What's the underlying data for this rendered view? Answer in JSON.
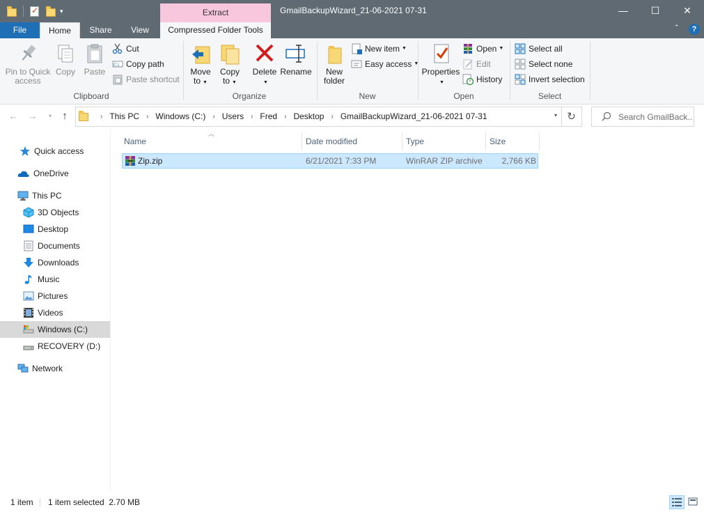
{
  "window": {
    "title": "GmailBackupWizard_21-06-2021 07-31",
    "contextual_tab_header": "Extract",
    "minimize": "—",
    "maximize": "☐",
    "close": "✕"
  },
  "ribbon_tabs": [
    "File",
    "Home",
    "Share",
    "View",
    "Compressed Folder Tools"
  ],
  "ribbon": {
    "clipboard": {
      "label": "Clipboard",
      "pin": [
        "Pin to Quick",
        "access"
      ],
      "copy": "Copy",
      "paste": "Paste",
      "cut": "Cut",
      "copy_path": "Copy path",
      "paste_shortcut": "Paste shortcut"
    },
    "organize": {
      "label": "Organize",
      "move_to": [
        "Move",
        "to"
      ],
      "copy_to": [
        "Copy",
        "to"
      ],
      "delete": "Delete",
      "rename": "Rename"
    },
    "new": {
      "label": "New",
      "new_folder": [
        "New",
        "folder"
      ],
      "new_item": "New item",
      "easy_access": "Easy access"
    },
    "open": {
      "label": "Open",
      "properties": "Properties",
      "open": "Open",
      "edit": "Edit",
      "history": "History"
    },
    "select": {
      "label": "Select",
      "select_all": "Select all",
      "select_none": "Select none",
      "invert_selection": "Invert selection"
    }
  },
  "address": {
    "breadcrumbs": [
      "This PC",
      "Windows (C:)",
      "Users",
      "Fred",
      "Desktop",
      "GmailBackupWizard_21-06-2021 07-31"
    ],
    "search_placeholder": "Search GmailBack..."
  },
  "sidebar": {
    "items": [
      {
        "label": "Quick access",
        "icon": "star-icon"
      },
      {
        "label": "OneDrive",
        "icon": "cloud-icon"
      },
      {
        "label": "This PC",
        "icon": "computer-icon"
      },
      {
        "label": "3D Objects",
        "icon": "cube-icon"
      },
      {
        "label": "Desktop",
        "icon": "desktop-icon"
      },
      {
        "label": "Documents",
        "icon": "document-icon"
      },
      {
        "label": "Downloads",
        "icon": "download-arrow-icon"
      },
      {
        "label": "Music",
        "icon": "music-note-icon"
      },
      {
        "label": "Pictures",
        "icon": "picture-icon"
      },
      {
        "label": "Videos",
        "icon": "film-icon"
      },
      {
        "label": "Windows (C:)",
        "icon": "drive-icon"
      },
      {
        "label": "RECOVERY (D:)",
        "icon": "drive-icon"
      },
      {
        "label": "Network",
        "icon": "network-icon"
      }
    ]
  },
  "file_list": {
    "columns": [
      "Name",
      "Date modified",
      "Type",
      "Size"
    ],
    "rows": [
      {
        "name": "Zip.zip",
        "date": "6/21/2021 7:33 PM",
        "type": "WinRAR ZIP archive",
        "size": "2,766 KB",
        "icon": "winrar-archive-icon"
      }
    ]
  },
  "status": {
    "item_count": "1 item",
    "selection": "1 item selected  2.70 MB"
  },
  "colors": {
    "titlebar": "#5f6a72",
    "file_tab": "#1e6fb6",
    "contextual_tab": "#f8c7dd",
    "selection": "#cce8ff",
    "selection_border": "#99d1ff"
  }
}
